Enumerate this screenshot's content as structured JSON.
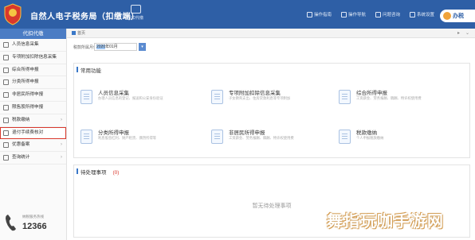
{
  "app": {
    "title": "自然人电子税务局（扣缴端）"
  },
  "topbar": {
    "monitor_label": "代扣代缴",
    "links": [
      {
        "label": "操作指南",
        "icon": "book-icon"
      },
      {
        "label": "操作导航",
        "icon": "compass-icon"
      },
      {
        "label": "问题咨询",
        "icon": "chat-icon"
      },
      {
        "label": "系统设置",
        "icon": "gear-icon"
      }
    ],
    "user_label": "办税"
  },
  "sidebar": {
    "header": "代扣代缴",
    "items": [
      {
        "label": "人员信息采集",
        "icon": "person-icon"
      },
      {
        "label": "专项附加扣除信息采集",
        "icon": "form-icon"
      },
      {
        "label": "综合所得申报",
        "icon": "report-icon"
      },
      {
        "label": "分类所得申报",
        "icon": "report-icon"
      },
      {
        "label": "非居民所得申报",
        "icon": "report-icon"
      },
      {
        "label": "限售股所得申报",
        "icon": "report-icon"
      },
      {
        "label": "税款缴纳",
        "icon": "money-icon",
        "expandable": true
      },
      {
        "label": "退付手续费核对",
        "icon": "check-icon",
        "selected": true
      },
      {
        "label": "优惠备案",
        "icon": "file-icon",
        "expandable": true
      },
      {
        "label": "查询统计",
        "icon": "chart-icon",
        "expandable": true
      }
    ],
    "hotline_caption": "纳税服务热线",
    "hotline_number": "12366"
  },
  "breadcrumb": {
    "home": "首页"
  },
  "period": {
    "label": "税款所属月份",
    "value_year": "2020",
    "value_rest": "年01月",
    "button": "▾"
  },
  "common_functions": {
    "title": "常用功能",
    "items": [
      {
        "name": "人员信息采集",
        "desc": "办理人员信息的登记、报送和公安身份验证"
      },
      {
        "name": "专项附加扣除信息采集",
        "desc": "子女教育支出、住房贷款利息等专项附加"
      },
      {
        "name": "综合所得申报",
        "desc": "工资薪金、劳务报酬、稿酬、特许权使用费"
      },
      {
        "name": "分类所得申报",
        "desc": "利息股息红利、财产租赁、偶然所得等"
      },
      {
        "name": "非居民所得申报",
        "desc": "工资薪金、劳务报酬、稿酬、特许权使用费"
      },
      {
        "name": "税款缴纳",
        "desc": "个人申报税款缴纳"
      }
    ]
  },
  "todo": {
    "title": "待处理事项",
    "count": "(0)",
    "empty_text": "暂无待处理事项"
  },
  "watermark": "舞指玩咖手游网"
}
